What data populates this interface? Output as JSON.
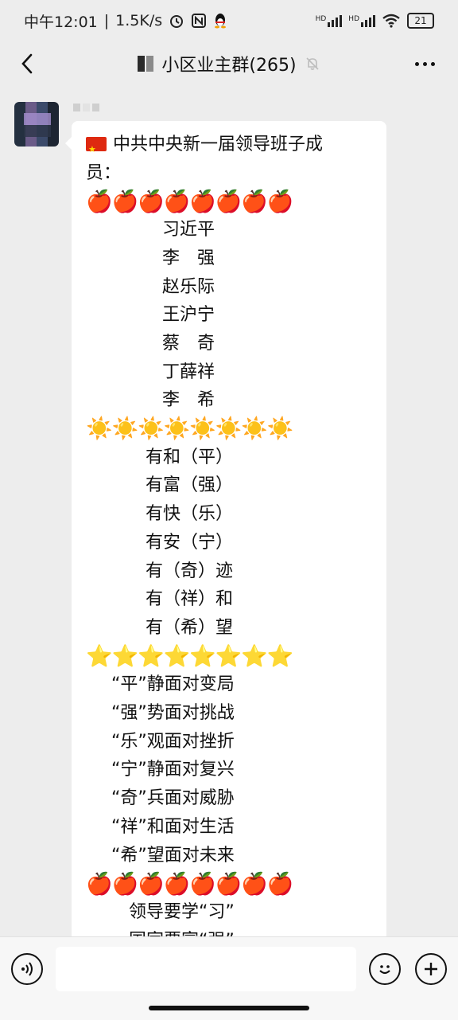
{
  "status_bar": {
    "time": "中午12:01",
    "separator": "|",
    "network_speed": "1.5K/s",
    "alarm_icon": "alarm-icon",
    "nfc_icon": "nfc-icon",
    "qq_icon": "qq-penguin-icon",
    "signal1_label": "HD",
    "signal2_label": "HD",
    "wifi_icon": "wifi-icon",
    "battery_level": "21"
  },
  "header": {
    "title": "小区业主群(265)",
    "muted_icon": "bell-muted-icon",
    "back_icon": "back-chevron-icon",
    "more_icon": "more-dots-icon"
  },
  "message": {
    "line_header_1": "中共中央新一届领导班子成",
    "line_header_2": "员：",
    "apple_row": [
      "🍎",
      "🍎",
      "🍎",
      "🍎",
      "🍎",
      "🍎",
      "🍎",
      "🍎"
    ],
    "sun_row": [
      "☀️",
      "☀️",
      "☀️",
      "☀️",
      "☀️",
      "☀️",
      "☀️",
      "☀️"
    ],
    "star_row": [
      "⭐",
      "⭐",
      "⭐",
      "⭐",
      "⭐",
      "⭐",
      "⭐",
      "⭐"
    ],
    "names": [
      "习近平",
      "李　强",
      "赵乐际",
      "王沪宁",
      "蔡　奇",
      "丁薛祥",
      "李　希"
    ],
    "wishes": [
      "有和（平）",
      "有富（强）",
      "有快（乐）",
      "有安（宁）",
      "有（奇）迹",
      "有（祥）和",
      "有（希）望"
    ],
    "mottos": [
      "“平”静面对变局",
      "“强”势面对挑战",
      "“乐”观面对挫折",
      "“宁”静面对复兴",
      "“奇”兵面对威胁",
      "“祥”和面对生活",
      "“希”望面对未来"
    ],
    "tail_lines": [
      "领导要学“习”",
      "国家要富“强”"
    ]
  },
  "input_bar": {
    "voice_icon": "voice-icon",
    "emoji_icon": "smiley-icon",
    "plus_icon": "plus-icon",
    "input_value": ""
  }
}
